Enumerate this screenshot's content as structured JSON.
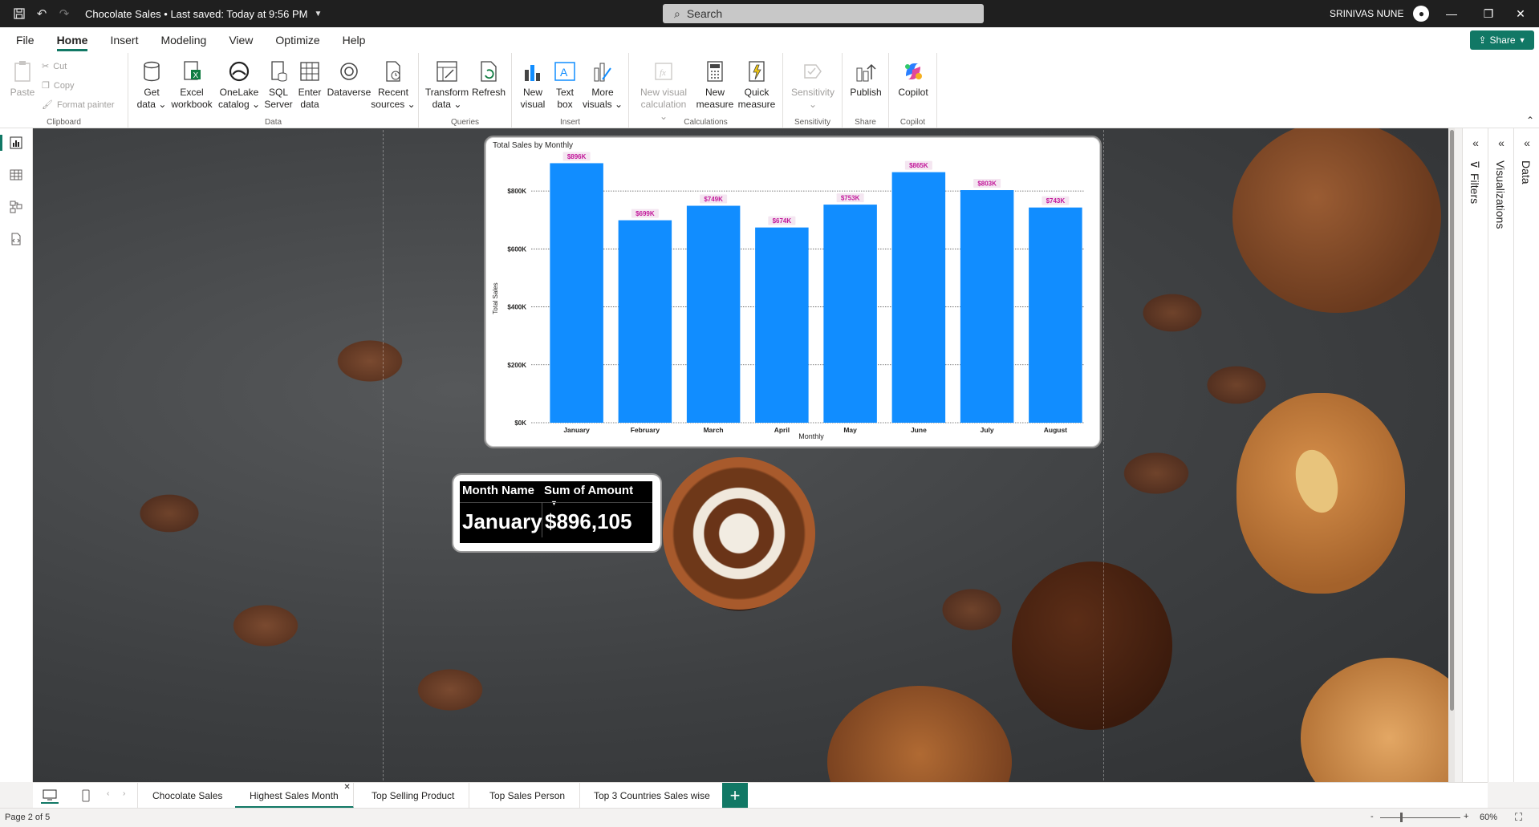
{
  "titlebar": {
    "doc_title": "Chocolate Sales • Last saved: Today at 9:56 PM",
    "search_placeholder": "Search",
    "user_name": "SRINIVAS NUNE",
    "minimize": "—",
    "restore": "❐",
    "close": "✕"
  },
  "menu": {
    "tabs": [
      "File",
      "Home",
      "Insert",
      "Modeling",
      "View",
      "Optimize",
      "Help"
    ],
    "active": "Home",
    "share_label": "Share"
  },
  "ribbon": {
    "clipboard": {
      "label": "Clipboard",
      "paste": "Paste",
      "cut": "Cut",
      "copy": "Copy",
      "format_painter": "Format painter"
    },
    "data": {
      "label": "Data",
      "get_data": [
        "Get",
        "data"
      ],
      "excel": [
        "Excel",
        "workbook"
      ],
      "onelake": [
        "OneLake",
        "catalog"
      ],
      "sql": [
        "SQL",
        "Server"
      ],
      "enter": [
        "Enter",
        "data"
      ],
      "dataverse": "Dataverse",
      "recent": [
        "Recent",
        "sources"
      ]
    },
    "queries": {
      "label": "Queries",
      "transform": [
        "Transform",
        "data"
      ],
      "refresh": "Refresh"
    },
    "insert": {
      "label": "Insert",
      "new_visual": [
        "New",
        "visual"
      ],
      "text_box": [
        "Text",
        "box"
      ],
      "more_visuals": [
        "More",
        "visuals"
      ]
    },
    "calculations": {
      "label": "Calculations",
      "new_visual_calc": [
        "New visual",
        "calculation"
      ],
      "new_measure": [
        "New",
        "measure"
      ],
      "quick_measure": [
        "Quick",
        "measure"
      ]
    },
    "sensitivity": {
      "label": "Sensitivity",
      "sensitivity": "Sensitivity"
    },
    "share": {
      "label": "Share",
      "publish": "Publish"
    },
    "copilot": {
      "label": "Copilot",
      "copilot": "Copilot"
    }
  },
  "panes": {
    "filters": "Filters",
    "visualizations": "Visualizations",
    "data": "Data"
  },
  "chart": {
    "title": "Total Sales by Monthly",
    "bar_color": "#118DFF",
    "label_color": "#C2189A"
  },
  "chart_data": {
    "type": "bar",
    "title": "Total Sales by Monthly",
    "xlabel": "Monthly",
    "ylabel": "Total Sales",
    "categories": [
      "January",
      "February",
      "March",
      "April",
      "May",
      "June",
      "July",
      "August"
    ],
    "values": [
      896,
      699,
      749,
      674,
      753,
      865,
      803,
      743
    ],
    "data_labels": [
      "$896K",
      "$699K",
      "$749K",
      "$674K",
      "$753K",
      "$865K",
      "$803K",
      "$743K"
    ],
    "y_ticks": [
      0,
      200,
      400,
      600,
      800
    ],
    "y_tick_labels": [
      "$0K",
      "$200K",
      "$400K",
      "$600K",
      "$800K"
    ],
    "ylim": [
      0,
      900
    ],
    "grid": true,
    "unit": "thousands USD"
  },
  "table": {
    "headers": [
      "Month Name",
      "Sum of Amount"
    ],
    "rows": [
      [
        "January",
        "$896,105"
      ]
    ]
  },
  "pages": {
    "tabs": [
      "Chocolate Sales",
      "Highest Sales Month",
      "Top Selling Product",
      "Top Sales Person",
      "Top 3 Countries Sales wise"
    ],
    "active": "Highest Sales Month",
    "add": "+"
  },
  "status": {
    "page_indicator": "Page 2 of 5",
    "zoom": "60%"
  }
}
